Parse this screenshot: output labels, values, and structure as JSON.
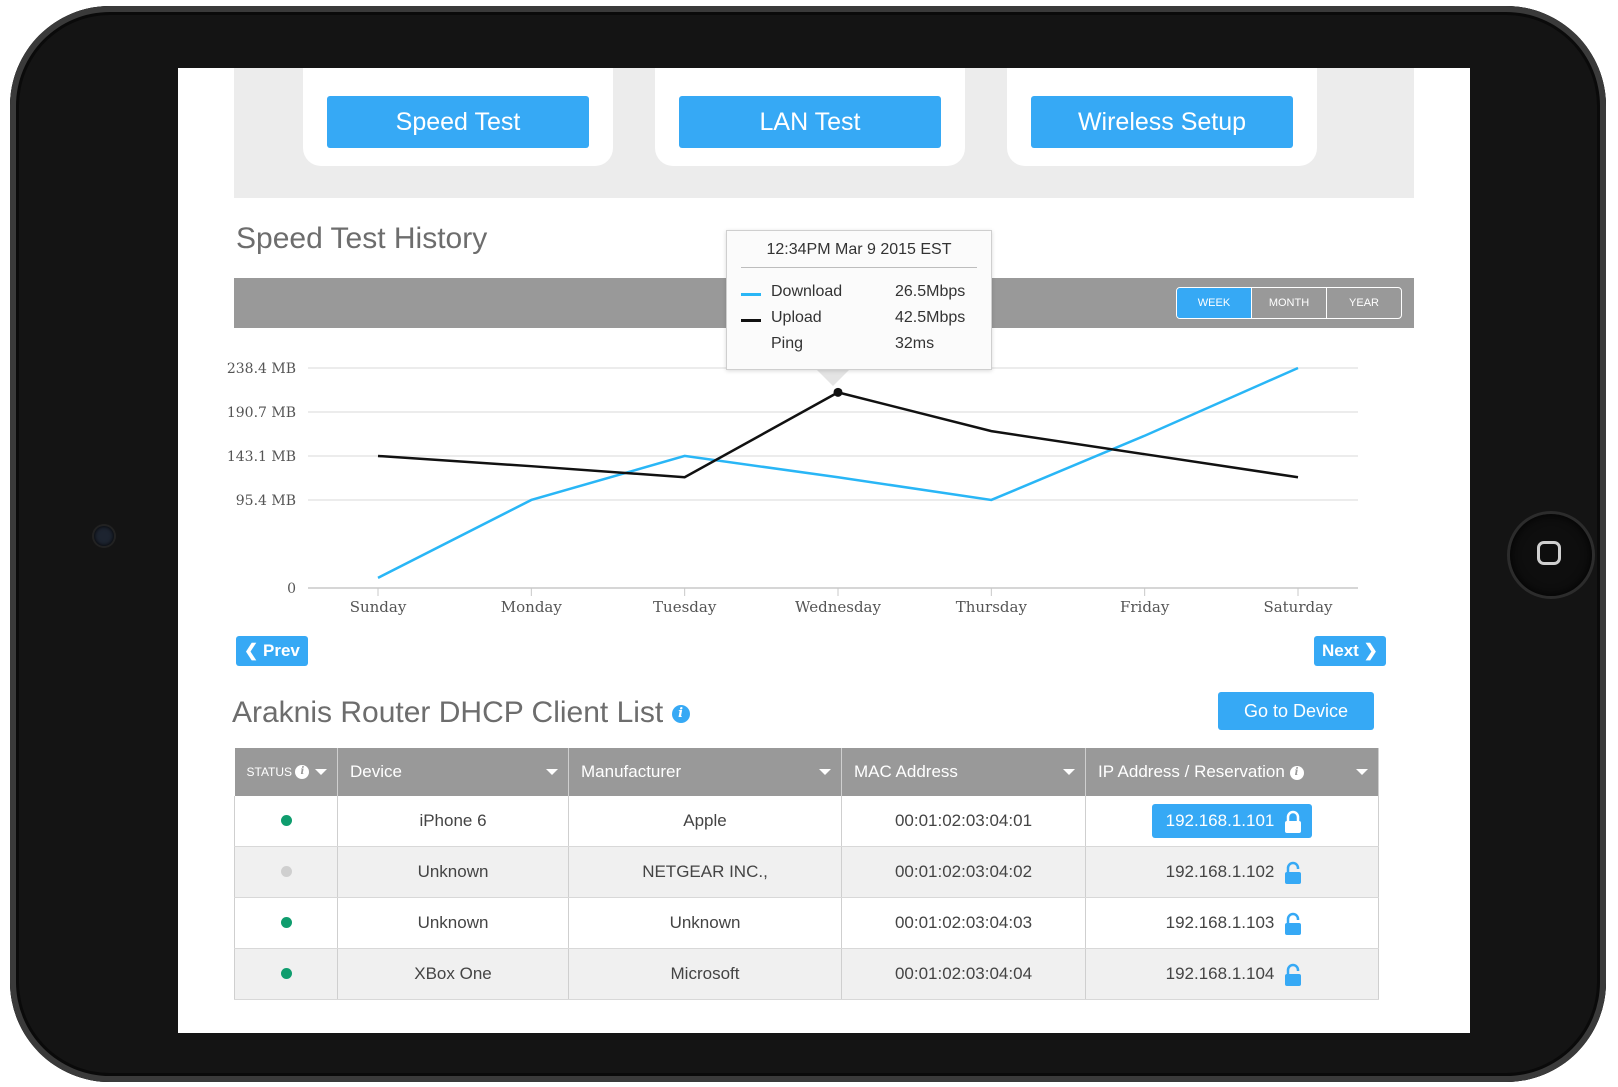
{
  "actions": {
    "speed_test": "Speed Test",
    "lan_test": "LAN Test",
    "wireless_setup": "Wireless Setup"
  },
  "history": {
    "title": "Speed Test History",
    "periods": [
      "WEEK",
      "MONTH",
      "YEAR"
    ],
    "active_period": "WEEK",
    "prev_label": "Prev",
    "next_label": "Next"
  },
  "tooltip": {
    "title": "12:34PM Mar 9 2015 EST",
    "rows": [
      {
        "label": "Download",
        "value": "26.5Mbps",
        "color": "#29b6f6"
      },
      {
        "label": "Upload",
        "value": "42.5Mbps",
        "color": "#111111"
      },
      {
        "label": "Ping",
        "value": "32ms",
        "color": ""
      }
    ]
  },
  "chart_data": {
    "type": "line",
    "categories": [
      "Sunday",
      "Monday",
      "Tuesday",
      "Wednesday",
      "Thursday",
      "Friday",
      "Saturday"
    ],
    "y_ticks": [
      "0",
      "95.4 MB",
      "143.1 MB",
      "190.7 MB",
      "238.4 MB"
    ],
    "y_tick_values": [
      0,
      95.4,
      143.1,
      190.7,
      238.4
    ],
    "ylim": [
      0,
      238.4
    ],
    "grid": true,
    "series": [
      {
        "name": "Download",
        "color": "#29b6f6",
        "values": [
          11,
          95.4,
          143.1,
          120,
          95.4,
          165,
          238.4
        ]
      },
      {
        "name": "Upload",
        "color": "#111111",
        "values": [
          143.1,
          132,
          120,
          212,
          170,
          145,
          120
        ]
      }
    ],
    "highlight": {
      "series": 1,
      "index": 3
    }
  },
  "dhcp": {
    "title": "Araknis Router DHCP Client List",
    "go_to_device": "Go to Device",
    "columns": [
      "STATUS",
      "Device",
      "Manufacturer",
      "MAC Address",
      "IP Address / Reservation"
    ],
    "rows": [
      {
        "status": "online",
        "status_color": "#0f9d6e",
        "device": "iPhone 6",
        "manufacturer": "Apple",
        "mac": "00:01:02:03:04:01",
        "ip": "192.168.1.101",
        "reserved": true
      },
      {
        "status": "offline",
        "status_color": "#cfcfcf",
        "device": "Unknown",
        "manufacturer": "NETGEAR INC.,",
        "mac": "00:01:02:03:04:02",
        "ip": "192.168.1.102",
        "reserved": false
      },
      {
        "status": "online",
        "status_color": "#0f9d6e",
        "device": "Unknown",
        "manufacturer": "Unknown",
        "mac": "00:01:02:03:04:03",
        "ip": "192.168.1.103",
        "reserved": false
      },
      {
        "status": "online",
        "status_color": "#0f9d6e",
        "device": "XBox One",
        "manufacturer": "Microsoft",
        "mac": "00:01:02:03:04:04",
        "ip": "192.168.1.104",
        "reserved": false
      }
    ]
  },
  "colors": {
    "accent": "#36a9f5",
    "header_gray": "#999999"
  }
}
